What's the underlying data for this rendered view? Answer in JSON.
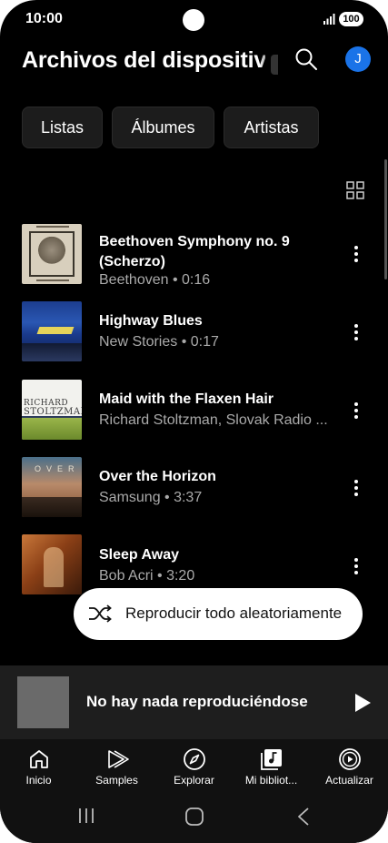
{
  "status_bar": {
    "time": "10:00",
    "battery": "100"
  },
  "header": {
    "title": "Archivos del dispositivo"
  },
  "chips": [
    {
      "label": "Listas"
    },
    {
      "label": "Álbumes"
    },
    {
      "label": "Artistas"
    }
  ],
  "tracks": [
    {
      "title": "Beethoven Symphony no. 9 (Scherzo)",
      "subtitle": "Beethoven • 0:16"
    },
    {
      "title": "Highway Blues",
      "subtitle": "New Stories • 0:17"
    },
    {
      "title": "Maid with the Flaxen Hair",
      "subtitle": "Richard Stoltzman, Slovak Radio ..."
    },
    {
      "title": "Over the Horizon",
      "subtitle": "Samsung • 3:37"
    },
    {
      "title": "Sleep Away",
      "subtitle": "Bob Acri • 3:20"
    }
  ],
  "album_art_text": {
    "stoltzman_line1": "RICHARD",
    "stoltzman_line2": "STOLTZMAN",
    "horizon_letters": "OVER"
  },
  "shuffle": {
    "label": "Reproducir todo aleatoriamente"
  },
  "mini_player": {
    "label": "No hay nada reproduciéndose"
  },
  "avatar": {
    "initial": "J",
    "color": "#1a73e8"
  },
  "bottom_nav": [
    {
      "label": "Inicio",
      "icon": "home-icon"
    },
    {
      "label": "Samples",
      "icon": "samples-icon"
    },
    {
      "label": "Explorar",
      "icon": "compass-icon"
    },
    {
      "label": "Mi bibliot...",
      "icon": "library-icon"
    },
    {
      "label": "Actualizar",
      "icon": "upgrade-icon"
    }
  ]
}
